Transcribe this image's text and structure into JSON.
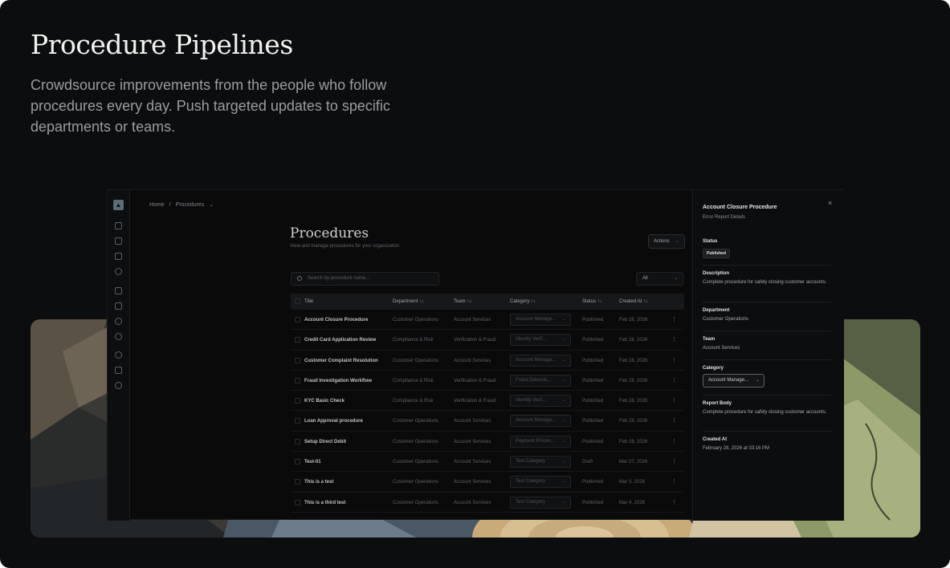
{
  "hero": {
    "title": "Procedure Pipelines",
    "subtitle": "Crowdsource improvements from the people who follow procedures every day. Push targeted updates to specific departments or teams."
  },
  "breadcrumb": {
    "home": "Home",
    "separator": "/",
    "current": "Procedures",
    "chevron": "⌄"
  },
  "page": {
    "title": "Procedures",
    "subtitle": "View and manage procedures for your organization",
    "actions_label": "Actions",
    "search_placeholder": "Search by procedure name...",
    "filter_value": "All"
  },
  "table": {
    "headers": {
      "title": "Title",
      "department": "Department",
      "team": "Team",
      "category": "Category",
      "status": "Status",
      "created": "Created At",
      "sort_icon": "↑↓"
    },
    "rows": [
      {
        "title": "Account Closure Procedure",
        "department": "Customer Operations",
        "team": "Account Services",
        "category": "Account Manage...",
        "status": "Published",
        "created": "Feb 28, 2026"
      },
      {
        "title": "Credit Card Application Review",
        "department": "Compliance & Risk",
        "team": "Verification & Fraud",
        "category": "Identity Verif...",
        "status": "Published",
        "created": "Feb 28, 2026"
      },
      {
        "title": "Customer Complaint Resolution",
        "department": "Customer Operations",
        "team": "Account Services",
        "category": "Account Manage...",
        "status": "Published",
        "created": "Feb 28, 2026"
      },
      {
        "title": "Fraud Investigation Workflow",
        "department": "Compliance & Risk",
        "team": "Verification & Fraud",
        "category": "Fraud Detectio...",
        "status": "Published",
        "created": "Feb 28, 2026"
      },
      {
        "title": "KYC Basic Check",
        "department": "Compliance & Risk",
        "team": "Verification & Fraud",
        "category": "Identity Verif...",
        "status": "Published",
        "created": "Feb 28, 2026"
      },
      {
        "title": "Loan Approval procedure",
        "department": "Customer Operations",
        "team": "Account Services",
        "category": "Account Manage...",
        "status": "Published",
        "created": "Feb 28, 2026"
      },
      {
        "title": "Setup Direct Debit",
        "department": "Customer Operations",
        "team": "Account Services",
        "category": "Payment Proces...",
        "status": "Published",
        "created": "Feb 28, 2026"
      },
      {
        "title": "Test-01",
        "department": "Customer Operations",
        "team": "Account Services",
        "category": "Test Category",
        "status": "Draft",
        "created": "Mar 27, 2026"
      },
      {
        "title": "This is a test",
        "department": "Customer Operations",
        "team": "Account Services",
        "category": "Test Category",
        "status": "Published",
        "created": "Mar 3, 2026"
      },
      {
        "title": "This is a third test",
        "department": "Customer Operations",
        "team": "Account Services",
        "category": "Test Category",
        "status": "Published",
        "created": "Mar 4, 2026"
      }
    ]
  },
  "panel": {
    "title": "Account Closure Procedure",
    "subtitle": "Error Report Details",
    "close_icon": "×",
    "status_label": "Status",
    "status_value": "Published",
    "description_label": "Description",
    "description_value": "Complete procedure for safely closing customer accounts.",
    "department_label": "Department",
    "department_value": "Customer Operations",
    "team_label": "Team",
    "team_value": "Account Services",
    "category_label": "Category",
    "category_value": "Account Manage...",
    "report_label": "Report Body",
    "report_value": "Complete procedure for safely closing customer accounts.",
    "created_label": "Created At",
    "created_value": "February 28, 2026 at 03:16 PM"
  },
  "icons": {
    "chevron": "⌄",
    "kebab": "⋮"
  },
  "colors": {
    "background": "#0c0d0f",
    "art_stone": "#3b3a36",
    "art_moss": "#8a9a6a",
    "art_wood": "#c7ad82"
  }
}
